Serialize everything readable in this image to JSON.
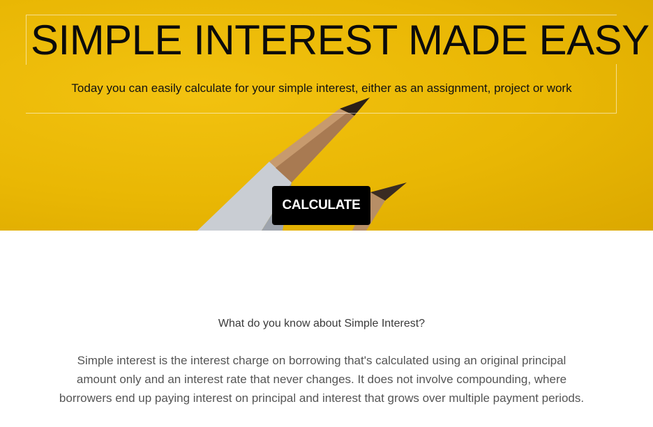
{
  "hero": {
    "title": "SIMPLE INTEREST MADE EASY",
    "subtitle": "Today you can easily calculate for your simple interest, either as an assignment, project or work",
    "cta_label": "CALCULATE",
    "background_color": "#e9b704",
    "image": "pencils"
  },
  "about": {
    "heading": "What do you know about Simple Interest?",
    "body": "Simple interest is the interest charge on borrowing that's calculated using an original principal amount only and an interest rate that never changes. It does not involve compounding, where borrowers end up paying interest on principal and interest that grows over multiple payment periods."
  }
}
